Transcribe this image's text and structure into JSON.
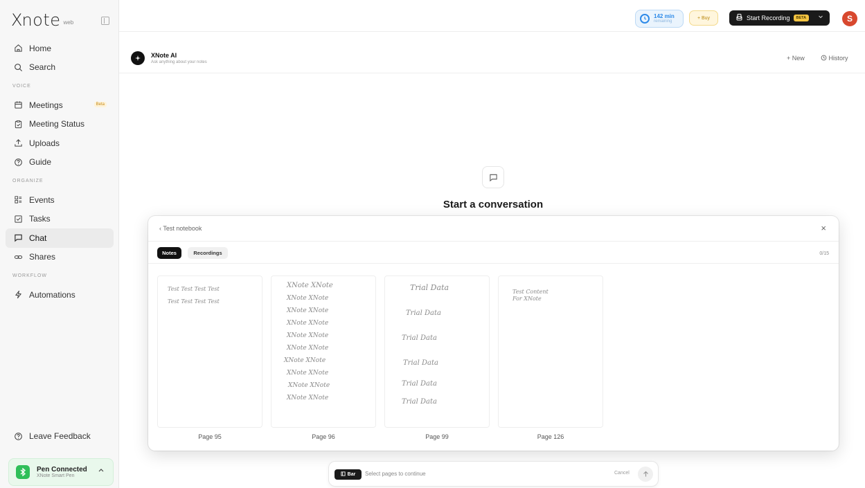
{
  "app": {
    "logo_mark": "X",
    "logo_text": "note",
    "logo_sub": "web"
  },
  "sidebar": {
    "items": [
      {
        "label": "Home",
        "icon": "home-icon"
      },
      {
        "label": "Search",
        "icon": "search-icon"
      }
    ],
    "sections": [
      {
        "label": "VOICE",
        "items": [
          {
            "label": "Meetings",
            "icon": "calendar-icon",
            "badge": "Beta"
          },
          {
            "label": "Meeting Status",
            "icon": "clipboard-icon"
          },
          {
            "label": "Uploads",
            "icon": "upload-icon"
          },
          {
            "label": "Guide",
            "icon": "help-icon"
          }
        ]
      },
      {
        "label": "ORGANIZE",
        "items": [
          {
            "label": "Events",
            "icon": "events-icon"
          },
          {
            "label": "Tasks",
            "icon": "tasks-icon"
          },
          {
            "label": "Chat",
            "icon": "chat-icon",
            "active": true
          },
          {
            "label": "Shares",
            "icon": "link-icon"
          }
        ]
      },
      {
        "label": "WORKFLOW",
        "items": [
          {
            "label": "Automations",
            "icon": "automation-icon"
          }
        ]
      }
    ],
    "feedback_label": "Leave Feedback",
    "pen": {
      "title": "Pen Connected",
      "subtitle": "XNote Smart Pen"
    }
  },
  "topbar": {
    "minutes_value": "142 min",
    "minutes_sub": "remaining",
    "buy_label": "+ Buy",
    "record_label": "Start Recording",
    "record_badge": "BETA",
    "avatar_initial": "S",
    "accent_blue": "#2d8ae8",
    "avatar_color": "#d8482e"
  },
  "chat": {
    "title": "XNote AI",
    "subtitle": "Ask anything about your notes",
    "new_label": "New",
    "history_label": "History",
    "empty_title": "Start a conversation"
  },
  "modal": {
    "back_label": "Test notebook",
    "tabs": [
      "Notes",
      "Recordings"
    ],
    "count": "0/15",
    "pages": [
      {
        "label": "Page 95",
        "lines": [
          "Test  Test  Test  Test",
          "Test  Test  Test  Test"
        ]
      },
      {
        "label": "Page 96",
        "lines": [
          "XNote   XNote",
          "XNote    XNote",
          "XNote    XNote",
          "XNote    XNote",
          "XNote    XNote",
          "XNote    XNote",
          "XNote    XNote",
          "XNote    XNote",
          "XNote    XNote",
          "XNote    XNote"
        ]
      },
      {
        "label": "Page 99",
        "lines": [
          "Trial   Data",
          "Trial   Data",
          "Trial   Data",
          "Trial   Data",
          "Trial   Data",
          "Trial   Data"
        ]
      },
      {
        "label": "Page 126",
        "lines": [
          "Test Content",
          "For XNote"
        ]
      }
    ]
  },
  "bottom_bar": {
    "chip_label": "Bar",
    "placeholder": "Select pages to continue",
    "cancel_label": "Cancel"
  }
}
